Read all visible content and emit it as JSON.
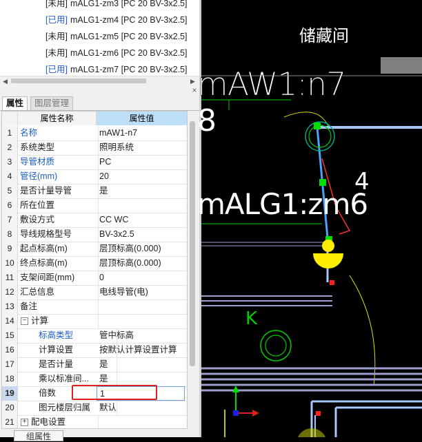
{
  "layer_list": {
    "items": [
      {
        "status": "[未用]",
        "used": false,
        "name": "mALG1-zm3 [PC 20 BV-3x2.5]"
      },
      {
        "status": "[已用]",
        "used": true,
        "name": "mALG1-zm4 [PC 20 BV-3x2.5]"
      },
      {
        "status": "[未用]",
        "used": false,
        "name": "mALG1-zm5 [PC 20 BV-3x2.5]"
      },
      {
        "status": "[未用]",
        "used": false,
        "name": "mALG1-zm6 [PC 20 BV-3x2.5]"
      },
      {
        "status": "[已用]",
        "used": true,
        "name": "mALG1-zm7 [PC 20 BV-3x2.5]"
      }
    ]
  },
  "panel": {
    "close_icon": "×",
    "tabs": [
      {
        "label": "属性",
        "active": true
      },
      {
        "label": "图层管理",
        "active": false
      }
    ],
    "columns": [
      "属性名称",
      "属性值"
    ],
    "rows": [
      {
        "num": "1",
        "name": "名称",
        "value": "mAW1-n7",
        "blue": true
      },
      {
        "num": "2",
        "name": "系统类型",
        "value": "照明系统"
      },
      {
        "num": "3",
        "name": "导管材质",
        "value": "PC",
        "blue": true
      },
      {
        "num": "4",
        "name": "管径(mm)",
        "value": "20",
        "blue": true
      },
      {
        "num": "5",
        "name": "是否计量导管",
        "value": "是"
      },
      {
        "num": "6",
        "name": "所在位置",
        "value": ""
      },
      {
        "num": "7",
        "name": "敷设方式",
        "value": "CC WC"
      },
      {
        "num": "8",
        "name": "导线规格型号",
        "value": "BV-3x2.5"
      },
      {
        "num": "9",
        "name": "起点标高(m)",
        "value": "层顶标高(0.000)"
      },
      {
        "num": "10",
        "name": "终点标高(m)",
        "value": "层顶标高(0.000)"
      },
      {
        "num": "11",
        "name": "支架间距(mm)",
        "value": "0"
      },
      {
        "num": "12",
        "name": "汇总信息",
        "value": "电线导管(电)"
      },
      {
        "num": "13",
        "name": "备注",
        "value": ""
      },
      {
        "num": "14",
        "name": "计算",
        "value": "",
        "group": "−"
      },
      {
        "num": "15",
        "name": "标高类型",
        "value": "管中标高",
        "blue": true,
        "indent": true
      },
      {
        "num": "16",
        "name": "计算设置",
        "value": "按默认计算设置计算",
        "indent": true
      },
      {
        "num": "17",
        "name": "是否计量",
        "value": "是",
        "indent": true
      },
      {
        "num": "18",
        "name": "乘以标准间...",
        "value": "是",
        "indent": true
      },
      {
        "num": "19",
        "name": "倍数",
        "value": "1",
        "indent": true,
        "selected": true
      },
      {
        "num": "20",
        "name": "图元楼层归属",
        "value": "默认",
        "indent": true
      },
      {
        "num": "21",
        "name": "配电设置",
        "value": "",
        "group": "+"
      }
    ],
    "bottom_button": "组属性"
  },
  "cad": {
    "texts": [
      "储藏间",
      "mAW1:n7",
      "8",
      "mALG1:zm6",
      "4",
      "K"
    ],
    "colors": {
      "background": "#000000",
      "pipe": "#4aa3ff",
      "node": "#00dd00",
      "fixture": "#ffee00",
      "annotation": "#ffffff"
    }
  }
}
